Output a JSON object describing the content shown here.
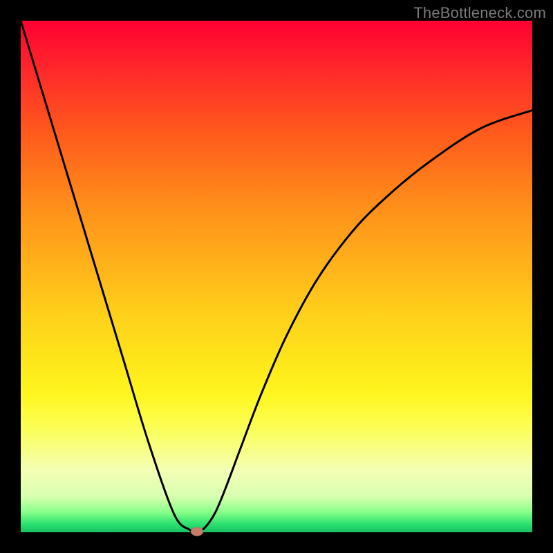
{
  "watermark": {
    "text": "TheBottleneck.com"
  },
  "colors": {
    "curve_stroke": "#000000",
    "marker_fill": "#c97b6a",
    "frame": "#000000"
  },
  "chart_data": {
    "type": "line",
    "title": "",
    "xlabel": "",
    "ylabel": "",
    "xlim": [
      0,
      100
    ],
    "ylim": [
      0,
      100
    ],
    "grid": false,
    "legend": false,
    "series": [
      {
        "name": "bottleneck-curve",
        "x": [
          0,
          5,
          10,
          15,
          20,
          25,
          30,
          33,
          34.5,
          36,
          38,
          40,
          43,
          47,
          52,
          58,
          65,
          72,
          80,
          90,
          100
        ],
        "values": [
          100,
          83.5,
          67,
          50.5,
          34,
          17.5,
          3.5,
          0.5,
          0.1,
          0.9,
          3.8,
          8.5,
          16.5,
          27,
          38.5,
          49.5,
          59,
          66,
          72.5,
          79,
          82.5
        ]
      }
    ],
    "annotations": [
      {
        "type": "point-marker",
        "x": 34.5,
        "y": 0.2,
        "color": "#c97b6a"
      }
    ],
    "background_gradient": {
      "direction": "vertical",
      "stops": [
        {
          "pos": 0.0,
          "color": "#ff0033"
        },
        {
          "pos": 0.1,
          "color": "#ff2a2a"
        },
        {
          "pos": 0.22,
          "color": "#ff5a1c"
        },
        {
          "pos": 0.35,
          "color": "#ff8a1a"
        },
        {
          "pos": 0.47,
          "color": "#ffb01a"
        },
        {
          "pos": 0.58,
          "color": "#ffd21a"
        },
        {
          "pos": 0.66,
          "color": "#fde51a"
        },
        {
          "pos": 0.73,
          "color": "#fff61f"
        },
        {
          "pos": 0.8,
          "color": "#fbff5a"
        },
        {
          "pos": 0.88,
          "color": "#f4ffb5"
        },
        {
          "pos": 0.93,
          "color": "#d8ffb0"
        },
        {
          "pos": 0.96,
          "color": "#8aff8a"
        },
        {
          "pos": 0.985,
          "color": "#28e06f"
        },
        {
          "pos": 1.0,
          "color": "#18c062"
        }
      ]
    }
  }
}
